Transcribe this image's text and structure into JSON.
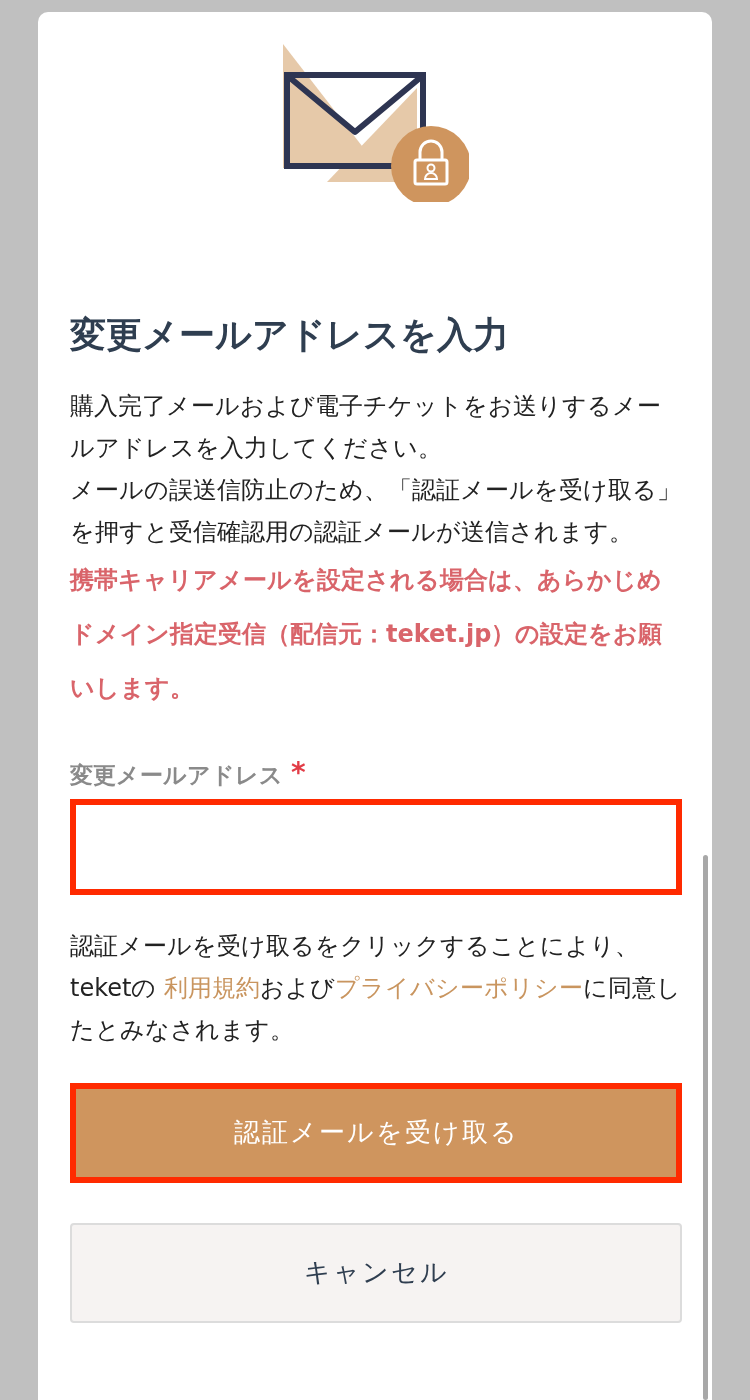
{
  "title": "変更メールアドレスを入力",
  "description": [
    "購入完了メールおよび電子チケットをお送りするメールアドレスを入力してください。",
    "メールの誤送信防止のため、「認証メールを受け取る」を押すと受信確認用の認証メールが送信されます。"
  ],
  "warning": "携帯キャリアメールを設定される場合は、あらかじめドメイン指定受信（配信元：teket.jp）の設定をお願いします。",
  "email_field": {
    "label": "変更メールアドレス",
    "required_mark": "*",
    "required": true
  },
  "agreement": [
    {
      "kind": "text",
      "text": "認証メールを受け取るをクリックすることにより、teketの "
    },
    {
      "kind": "link",
      "text": "利用規約"
    },
    {
      "kind": "text",
      "text": "および"
    },
    {
      "kind": "link",
      "text": "プライバシーポリシー"
    },
    {
      "kind": "text",
      "text": "に同意したとみなされます。"
    }
  ],
  "buttons": [
    {
      "kind": "primary",
      "label": "認証メールを受け取る"
    },
    {
      "kind": "secondary",
      "label": "キャンセル"
    }
  ]
}
